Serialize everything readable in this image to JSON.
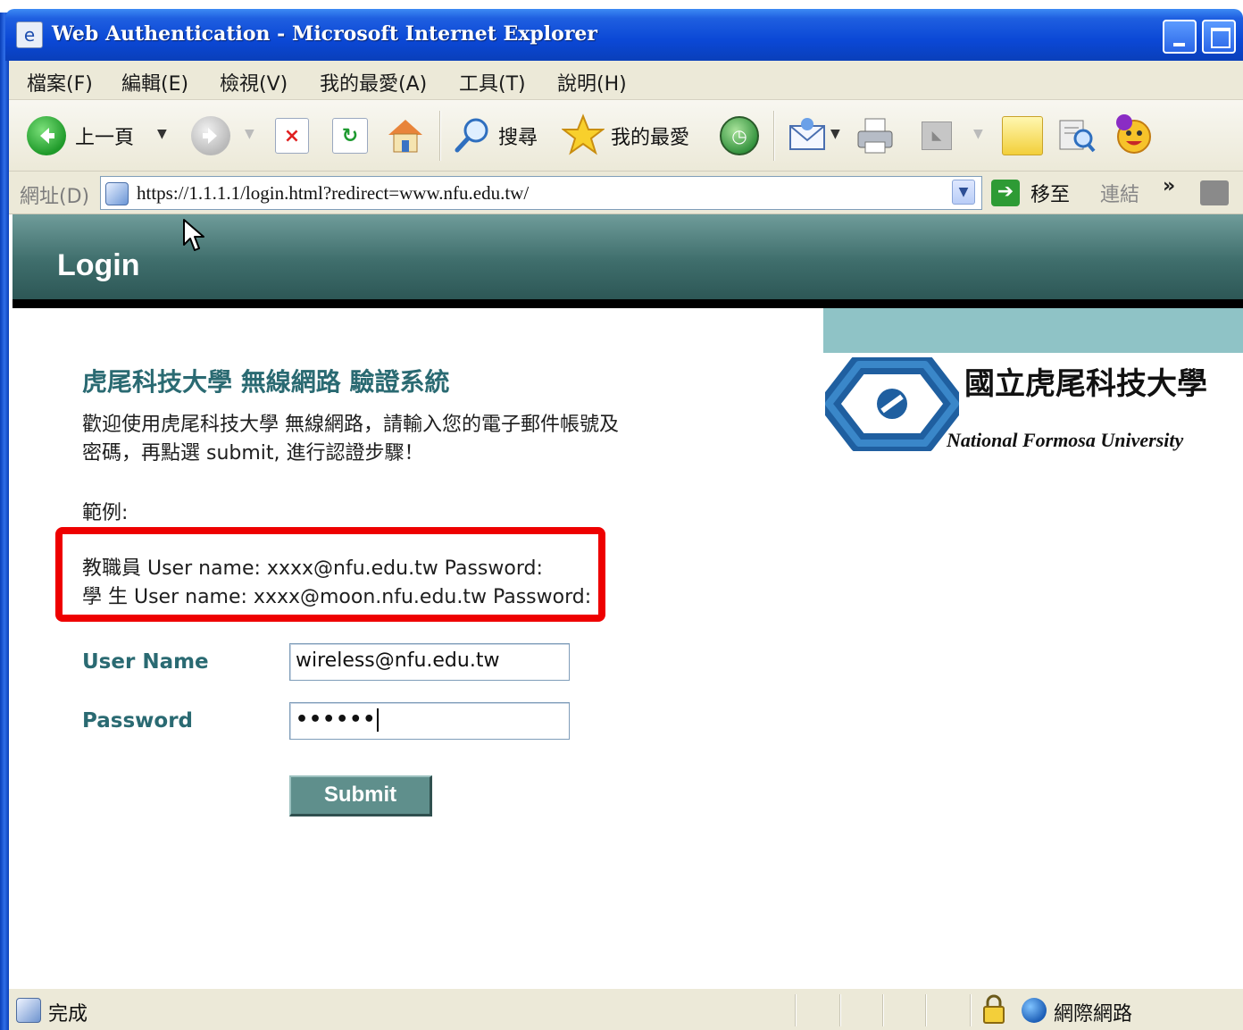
{
  "window": {
    "title": "Web Authentication - Microsoft Internet Explorer"
  },
  "menu": {
    "items": [
      {
        "label": "檔案(F)"
      },
      {
        "label": "編輯(E)"
      },
      {
        "label": "檢視(V)"
      },
      {
        "label": "我的最愛(A)"
      },
      {
        "label": "工具(T)"
      },
      {
        "label": "說明(H)"
      }
    ]
  },
  "toolbar": {
    "back_label": "上一頁",
    "search_label": "搜尋",
    "favorites_label": "我的最愛"
  },
  "address": {
    "label": "網址(D)",
    "url": "https://1.1.1.1/login.html?redirect=www.nfu.edu.tw/",
    "go_label": "移至",
    "links_label": "連結",
    "more": "»"
  },
  "page": {
    "header_title": "Login",
    "logo_cn": "國立虎尾科技大學",
    "logo_en": "National Formosa University",
    "heading": "虎尾科技大學 無線網路 驗證系統",
    "intro_line1": "歡迎使用虎尾科技大學 無線網路，請輸入您的電子郵件帳號及",
    "intro_line2": "密碼，再點選 submit, 進行認證步驟！",
    "example_label": "範例:",
    "example_staff": "教職員 User name: xxxx@nfu.edu.tw Password:",
    "example_student": "學 生 User name: xxxx@moon.nfu.edu.tw Password:",
    "username_label": "User Name",
    "username_value": "wireless@nfu.edu.tw",
    "password_label": "Password",
    "password_value": "••••••",
    "submit_label": "Submit"
  },
  "status": {
    "text": "完成",
    "zone": "網際網路"
  },
  "colors": {
    "titlebar": "#0b48d6",
    "header_teal": "#3f6e6c",
    "heading_teal": "#2a6a72",
    "highlight_red": "#ee0000",
    "submit_bg": "#5f8f8c"
  }
}
